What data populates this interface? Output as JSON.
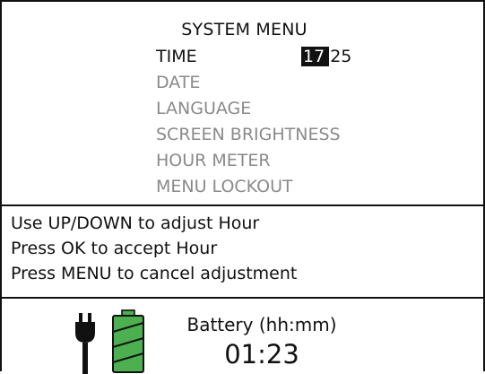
{
  "menu": {
    "title": "SYSTEM MENU",
    "items": [
      {
        "label": "TIME",
        "active": true
      },
      {
        "label": "DATE",
        "active": false
      },
      {
        "label": "LANGUAGE",
        "active": false
      },
      {
        "label": "SCREEN BRIGHTNESS",
        "active": false
      },
      {
        "label": "HOUR METER",
        "active": false
      },
      {
        "label": "MENU LOCKOUT",
        "active": false
      }
    ],
    "time": {
      "hour": "17",
      "minute": "25"
    }
  },
  "help": [
    "Use UP/DOWN to adjust Hour",
    "Press OK to accept Hour",
    "Press MENU to cancel adjustment"
  ],
  "status": {
    "battery_label": "Battery (hh:mm)",
    "battery_time": "01:23",
    "icons": [
      "power-plug-icon",
      "battery-icon"
    ],
    "colors": {
      "text": "#111111",
      "dim": "#8a8a8a",
      "battery_fill": "#4caf50",
      "highlight_bg": "#111111"
    }
  }
}
